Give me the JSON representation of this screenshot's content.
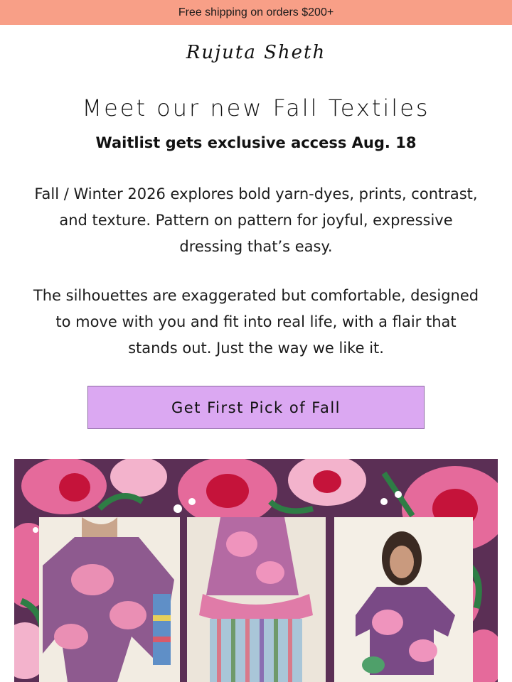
{
  "promo": {
    "text": "Free shipping on orders $200+"
  },
  "brand": {
    "logo_text": "Rujuta Sheth"
  },
  "hero_copy": {
    "headline": "Meet our new Fall Textiles",
    "subhead": "Waitlist gets exclusive access Aug. 18",
    "paragraph_1": "Fall / Winter 2026 explores bold yarn-dyes, prints, contrast, and texture. Pattern on pattern for joyful, expressive dressing that’s easy.",
    "paragraph_2": "The silhouettes are exaggerated but comfortable, designed to move with you and fit into real life, with a flair that stands out. Just the way we like it."
  },
  "cta": {
    "label": "Get First Pick of Fall"
  },
  "colors": {
    "promo_bg": "#f89f87",
    "cta_bg": "#dba8f2",
    "print_purple": "#5b2f55",
    "print_pink": "#e56a9b",
    "print_red": "#c5133a",
    "print_green": "#2e7d45",
    "photo_bg": "#f2ece2"
  }
}
